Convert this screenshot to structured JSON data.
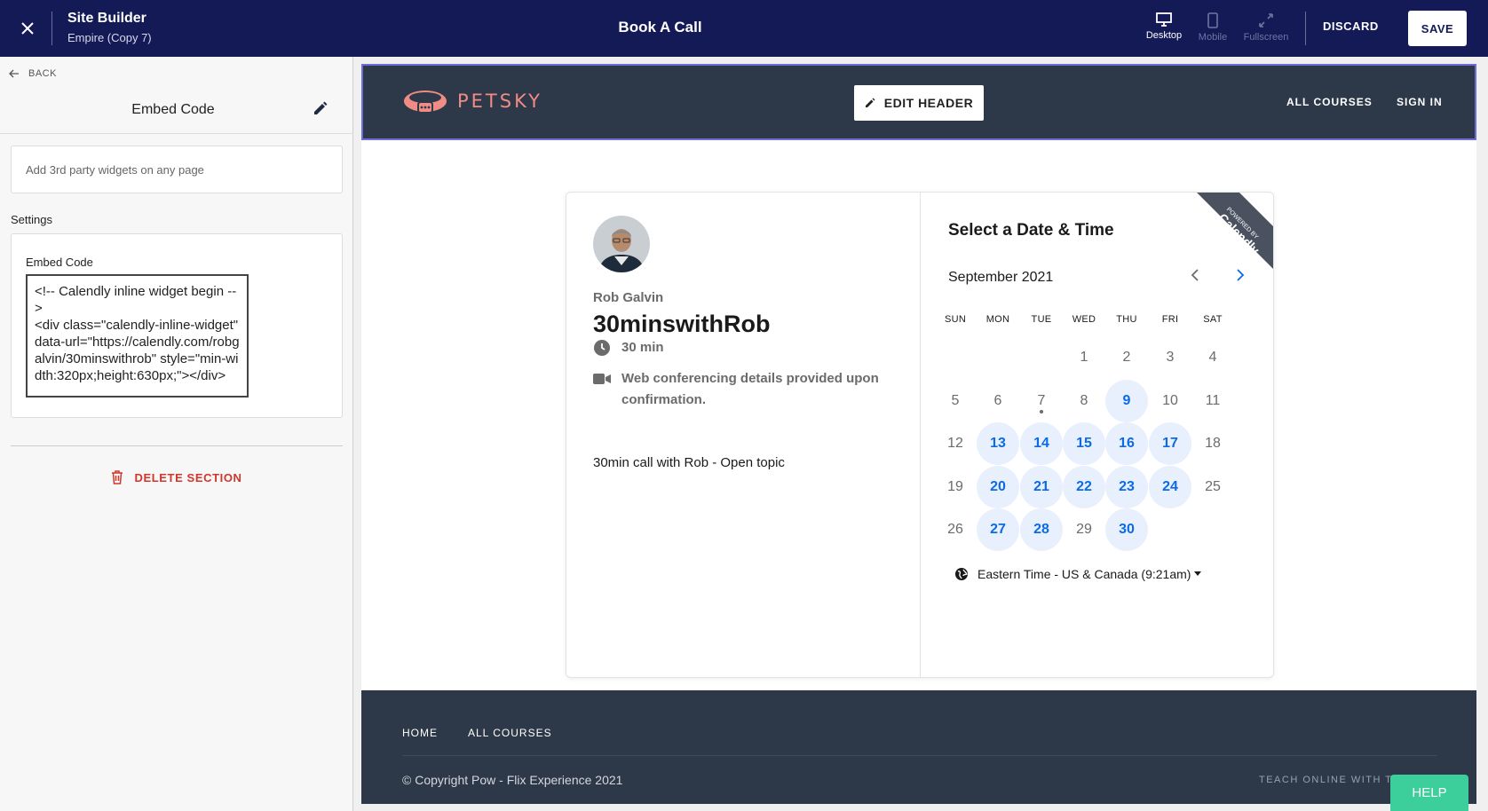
{
  "topbar": {
    "app_name": "Site Builder",
    "site_name": "Empire (Copy 7)",
    "page_title": "Book A Call",
    "views": [
      {
        "label": "Desktop",
        "icon": "desktop-icon",
        "active": true
      },
      {
        "label": "Mobile",
        "icon": "mobile-icon",
        "active": false
      },
      {
        "label": "Fullscreen",
        "icon": "fullscreen-icon",
        "active": false
      }
    ],
    "discard_label": "DISCARD",
    "save_label": "SAVE",
    "bg_color": "#141a56"
  },
  "panel": {
    "back_label": "BACK",
    "title": "Embed Code",
    "description": "Add 3rd party widgets on any page",
    "settings_label": "Settings",
    "embed_label": "Embed Code",
    "embed_code": "<!-- Calendly inline widget begin -->\n<div class=\"calendly-inline-widget\" data-url=\"https://calendly.com/robgalvin/30minswithrob\" style=\"min-width:320px;height:630px;\"></div>",
    "delete_label": "DELETE SECTION",
    "delete_color": "#d0362b"
  },
  "site": {
    "logo_text": "PETSKY",
    "edit_header_label": "EDIT HEADER",
    "nav": [
      "ALL COURSES",
      "SIGN IN"
    ],
    "header_bg": "#2d3848",
    "logo_color": "#f08b86"
  },
  "calendly": {
    "host": "Rob Galvin",
    "event_name": "30minswithRob",
    "duration": "30 min",
    "conferencing": "Web conferencing details provided upon confirmation.",
    "description": "30min call with Rob - Open topic",
    "select_title": "Select a Date & Time",
    "month": "September 2021",
    "weekdays": [
      "SUN",
      "MON",
      "TUE",
      "WED",
      "THU",
      "FRI",
      "SAT"
    ],
    "weeks": [
      [
        "",
        "",
        "",
        "1",
        "2",
        "3",
        "4"
      ],
      [
        "5",
        "6",
        "7",
        "8",
        "9",
        "10",
        "11"
      ],
      [
        "12",
        "13",
        "14",
        "15",
        "16",
        "17",
        "18"
      ],
      [
        "19",
        "20",
        "21",
        "22",
        "23",
        "24",
        "25"
      ],
      [
        "26",
        "27",
        "28",
        "29",
        "30",
        "",
        ""
      ]
    ],
    "available_days": [
      "9",
      "13",
      "14",
      "15",
      "16",
      "17",
      "20",
      "21",
      "22",
      "23",
      "24",
      "27",
      "28",
      "30"
    ],
    "today": "7",
    "timezone": "Eastern Time - US & Canada (9:21am)",
    "ribbon_small": "POWERED BY",
    "ribbon_brand": "Calendly",
    "accent_color": "#0b6be4"
  },
  "footer": {
    "links": [
      "HOME",
      "ALL COURSES"
    ],
    "copyright": "© Copyright Pow - Flix Experience 2021",
    "teach": "TEACH ONLINE WITH TH"
  },
  "help_label": "HELP"
}
